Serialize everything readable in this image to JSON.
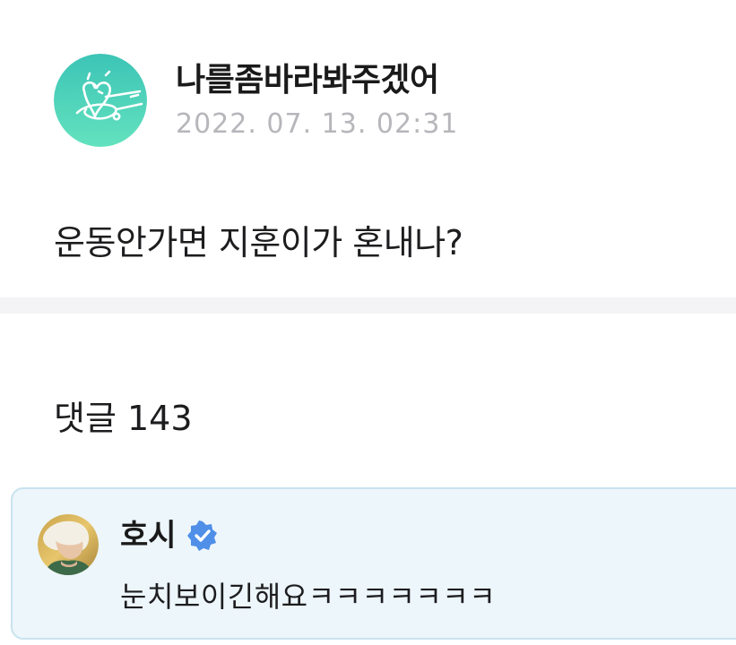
{
  "post": {
    "author_name": "나를좀바라봐주겠어",
    "date": "2022. 07. 13. 02:31",
    "body": "운동안가면 지훈이가 혼내나?",
    "avatar_icon": "heart-doodle-icon"
  },
  "comments": {
    "count_label": "댓글 143",
    "items": [
      {
        "author": "호시",
        "verified": true,
        "text": "눈치보이긴해요ㅋㅋㅋㅋㅋㅋㅋ"
      }
    ]
  },
  "colors": {
    "avatar_gradient_top": "#3fc6b4",
    "avatar_gradient_bottom": "#5fe0bf",
    "date_gray": "#b6b6bb",
    "comment_bg": "#edf6fb",
    "comment_border": "#c9e3ee",
    "verified_blue": "#4f8fe8",
    "divider": "#f4f4f6"
  }
}
